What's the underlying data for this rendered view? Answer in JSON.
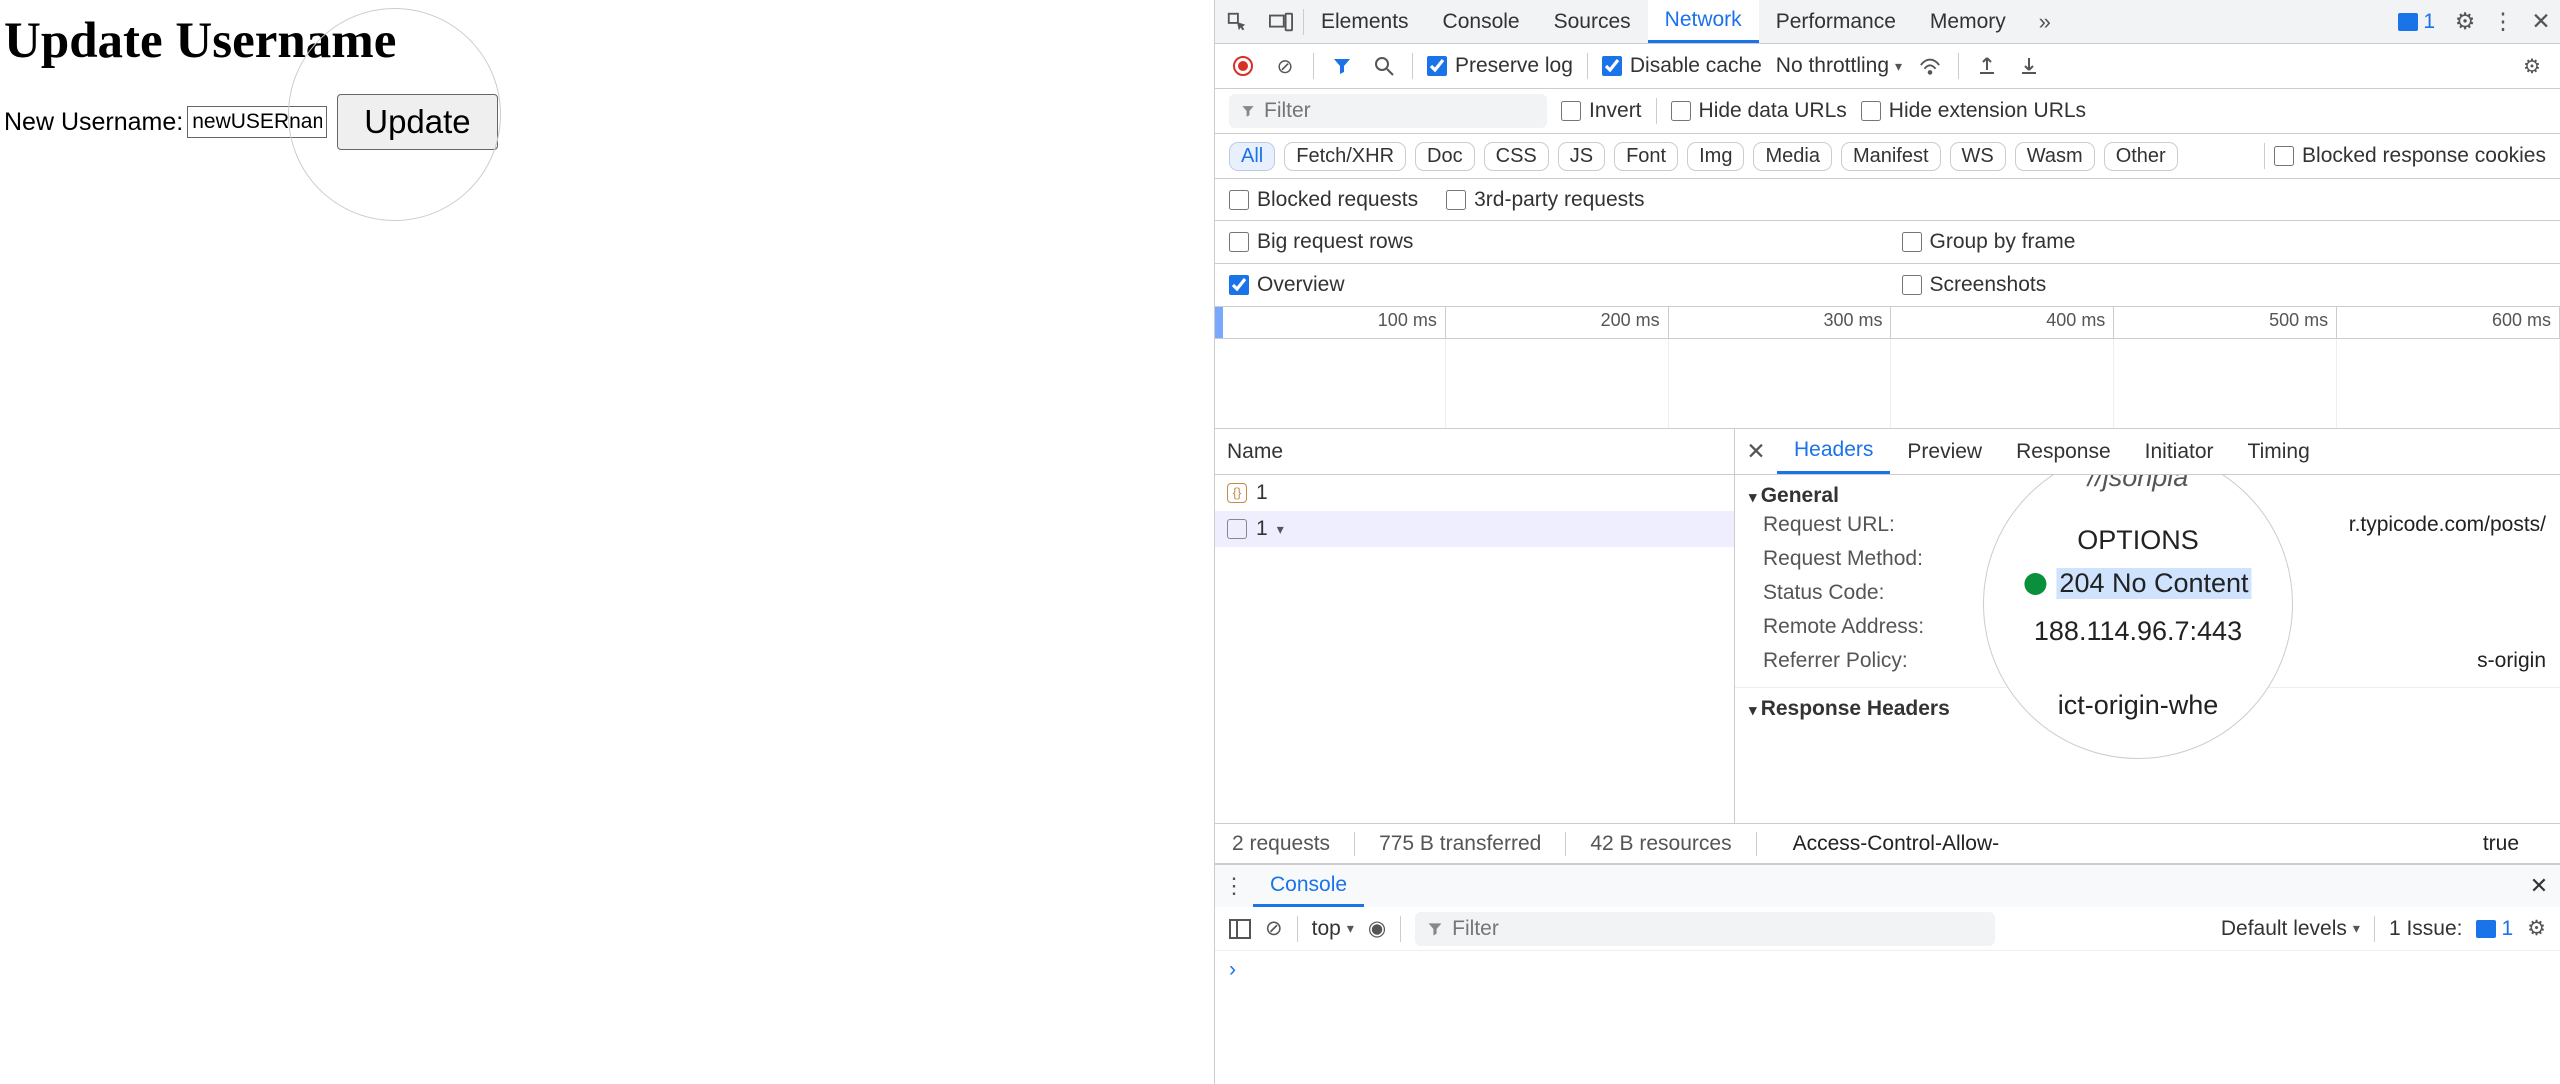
{
  "page": {
    "title": "Update Username",
    "label": "New Username:",
    "value": "newUSERname",
    "button": "Update"
  },
  "devtools": {
    "mainTabs": [
      "Elements",
      "Console",
      "Sources",
      "Network",
      "Performance",
      "Memory"
    ],
    "mainActive": "Network",
    "badgeCount": "1",
    "toolbar": {
      "preserve": "Preserve log",
      "disableCache": "Disable cache",
      "throttling": "No throttling"
    },
    "filter": {
      "placeholder": "Filter",
      "invert": "Invert",
      "hideData": "Hide data URLs",
      "hideExt": "Hide extension URLs"
    },
    "types": [
      "All",
      "Fetch/XHR",
      "Doc",
      "CSS",
      "JS",
      "Font",
      "Img",
      "Media",
      "Manifest",
      "WS",
      "Wasm",
      "Other"
    ],
    "typeActive": "All",
    "blockedCookies": "Blocked response cookies",
    "blockedReq": "Blocked requests",
    "thirdParty": "3rd-party requests",
    "bigRows": "Big request rows",
    "groupFrame": "Group by frame",
    "overview": "Overview",
    "screenshots": "Screenshots",
    "timeMarks": [
      "100 ms",
      "200 ms",
      "300 ms",
      "400 ms",
      "500 ms",
      "600 ms"
    ],
    "nameHeader": "Name",
    "rows": [
      {
        "icon": "json",
        "label": "1"
      },
      {
        "icon": "doc",
        "label": "1"
      }
    ],
    "detailTabs": [
      "Headers",
      "Preview",
      "Response",
      "Initiator",
      "Timing"
    ],
    "detailActive": "Headers",
    "general": {
      "title": "General",
      "url_k": "Request URL:",
      "url_v": "r.typicode.com/posts/",
      "method_k": "Request Method:",
      "status_k": "Status Code:",
      "remote_k": "Remote Address:",
      "referrer_k": "Referrer Policy:",
      "referrer_v": "s-origin"
    },
    "zoom": {
      "top": "//jsonpla",
      "method": "OPTIONS",
      "status": "204 No Content",
      "remote": "188.114.96.7:443",
      "bottom": "ict-origin-whe"
    },
    "responseHeaders": {
      "title": "Response Headers",
      "k": "Access-Control-Allow-",
      "v": "true"
    },
    "status": {
      "requests": "2 requests",
      "transferred": "775 B transferred",
      "resources": "42 B resources"
    },
    "drawer": {
      "tab": "Console",
      "top": "top",
      "filter": "Filter",
      "levels": "Default levels",
      "issue": "1 Issue:",
      "issueCount": "1"
    }
  }
}
